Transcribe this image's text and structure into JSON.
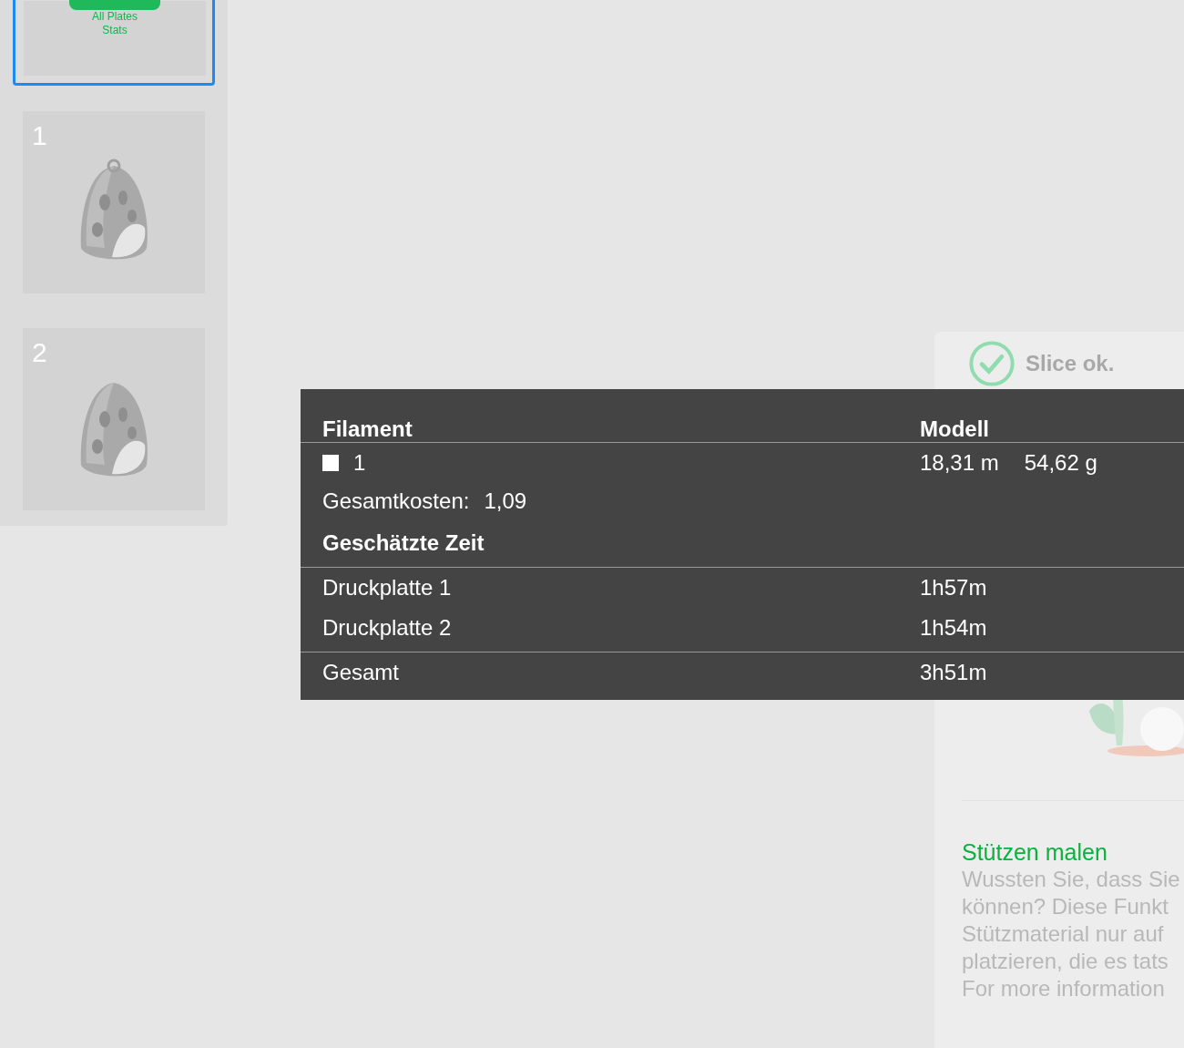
{
  "plates": [
    {
      "kind": "stats",
      "label": "All Plates Stats",
      "selected": true
    },
    {
      "kind": "plate",
      "number": "1",
      "selected": false
    },
    {
      "kind": "plate",
      "number": "2",
      "selected": false
    }
  ],
  "slice_panel": {
    "status": "Slice ok.",
    "tip_title": "Stützen malen",
    "tip_lines": [
      "Wussten Sie, dass Sie",
      "können? Diese Funkt",
      "Stützmaterial nur auf",
      "platzieren, die es tats",
      "For more information"
    ]
  },
  "stats_tooltip": {
    "filament_header": "Filament",
    "model_header": "Modell",
    "filaments": [
      {
        "number": "1",
        "color": "#ffffff",
        "length": "18,31 m",
        "weight": "54,62 g"
      }
    ],
    "cost_label": "Gesamtkosten:",
    "cost_value": "1,09",
    "time_header": "Geschätzte Zeit",
    "plate_times": [
      {
        "label": "Druckplatte 1",
        "time": "1h57m"
      },
      {
        "label": "Druckplatte 2",
        "time": "1h54m"
      }
    ],
    "total_label": "Gesamt",
    "total_time": "3h51m"
  }
}
